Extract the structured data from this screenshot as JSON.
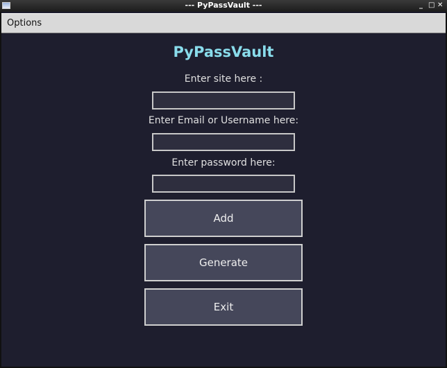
{
  "window": {
    "title": "--- PyPassVault ---",
    "controls": {
      "minimize": "_",
      "maximize": "□",
      "close": "✕"
    }
  },
  "menu": {
    "options": "Options"
  },
  "app": {
    "title": "PyPassVault"
  },
  "form": {
    "site_label": "Enter site here :",
    "site_value": "",
    "user_label": "Enter Email or Username here:",
    "user_value": "",
    "password_label": "Enter password here:",
    "password_value": ""
  },
  "buttons": {
    "add": "Add",
    "generate": "Generate",
    "exit": "Exit"
  },
  "colors": {
    "background": "#1e1e2e",
    "accent": "#89dceb",
    "button": "#45475a",
    "input": "#2e2e3e"
  }
}
